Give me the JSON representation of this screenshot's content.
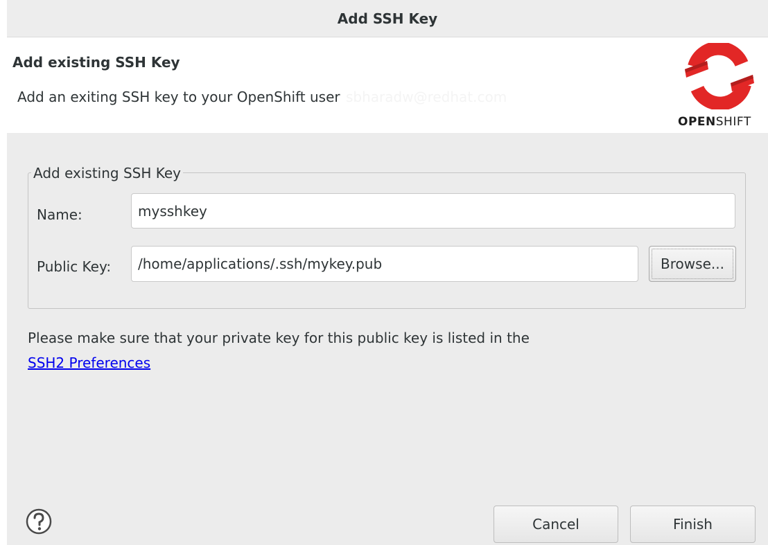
{
  "window": {
    "title": "Add SSH Key"
  },
  "banner": {
    "title": "Add existing SSH Key",
    "description": "Add an exiting SSH key to your OpenShift user",
    "user": "sbharadw@redhat.com",
    "logo_text_bold": "OPEN",
    "logo_text_light": "SHIFT",
    "logo_color": "#e22726",
    "logo_icon": "openshift-logo-icon"
  },
  "group": {
    "legend": "Add existing SSH Key",
    "name_label": "Name:",
    "name_value": "mysshkey",
    "public_key_label": "Public Key:",
    "public_key_value": "/home/applications/.ssh/mykey.pub",
    "browse_label": "Browse..."
  },
  "info": {
    "text": "Please make sure that your private key for this public key is listed in the",
    "link": "SSH2 Preferences"
  },
  "footer": {
    "help_icon": "question-mark-icon",
    "cancel_label": "Cancel",
    "finish_label": "Finish"
  }
}
